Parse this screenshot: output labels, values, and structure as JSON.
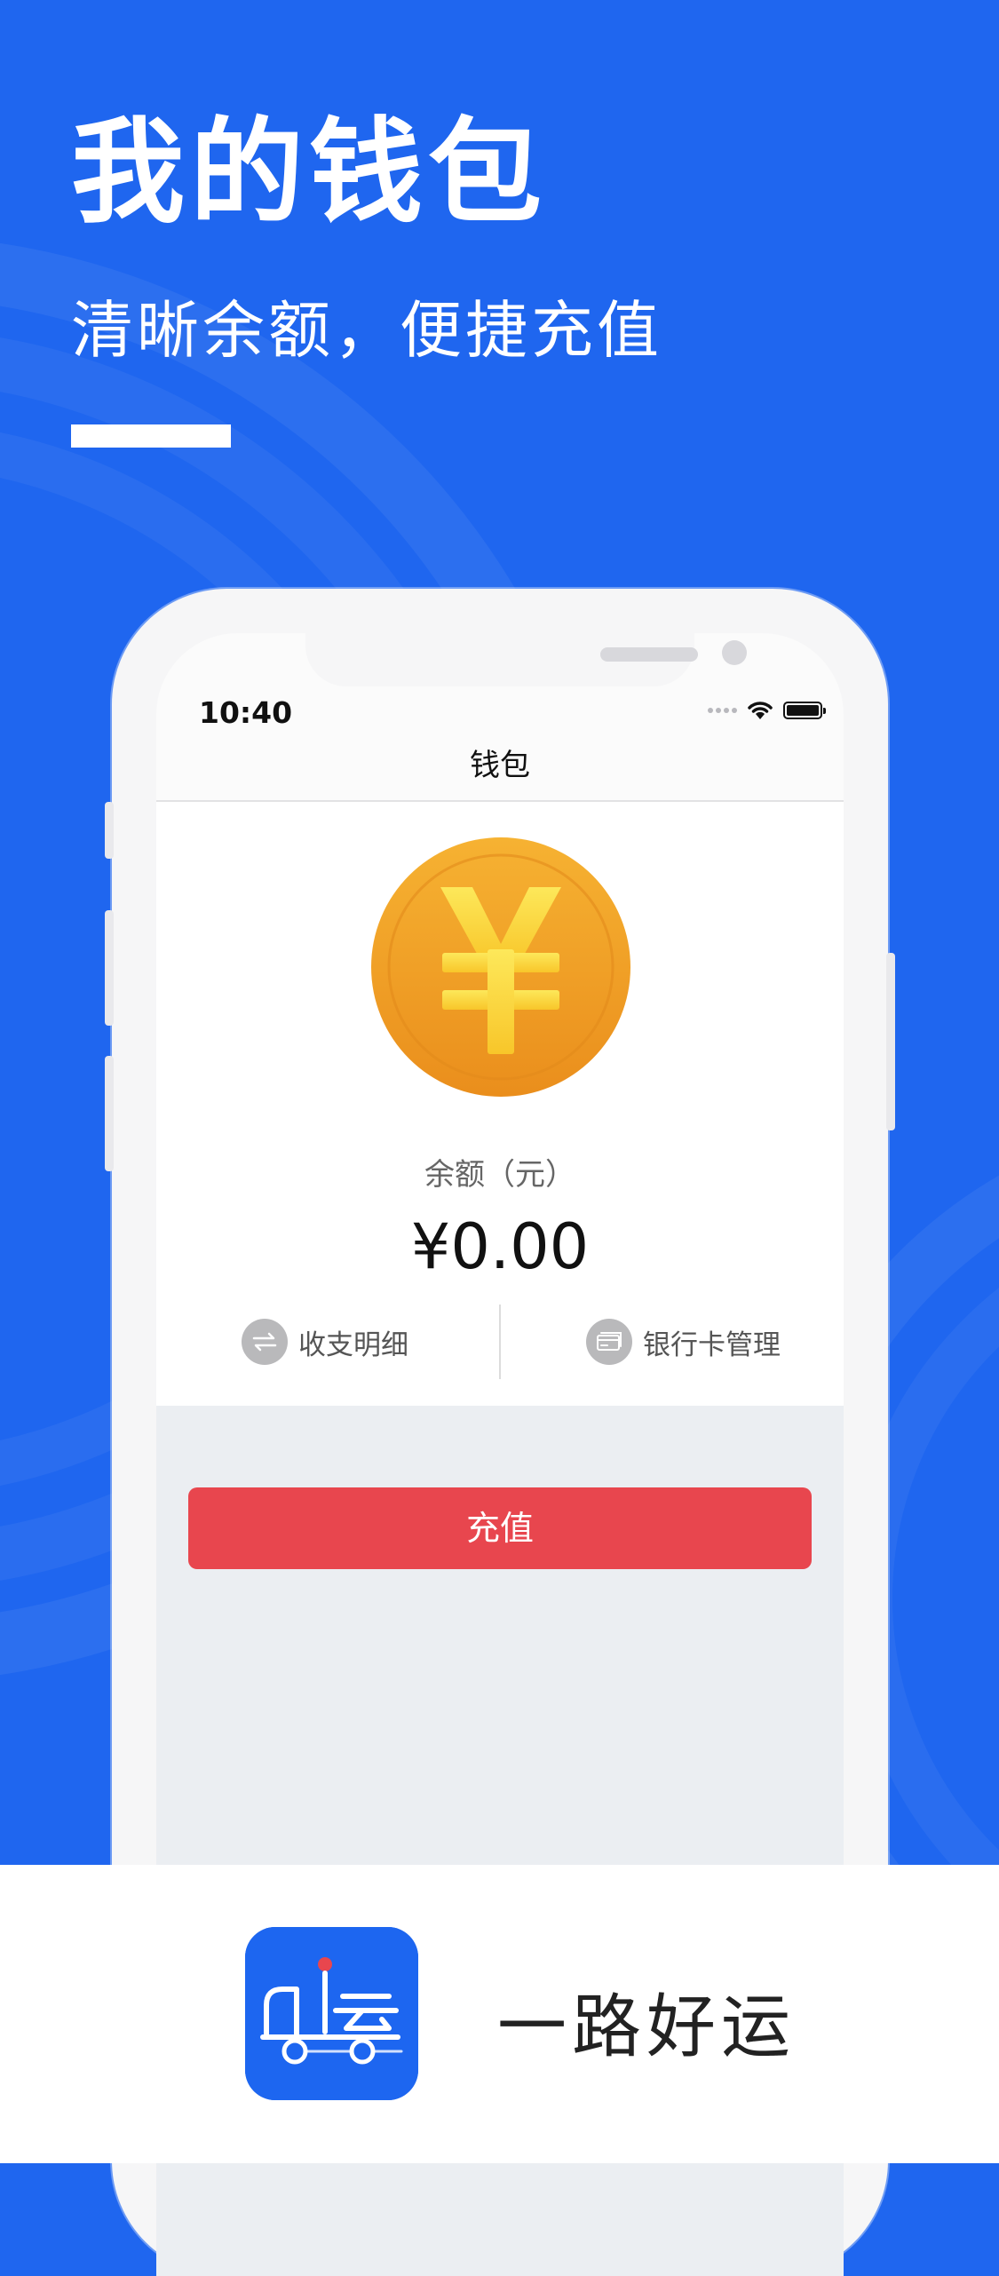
{
  "hero": {
    "title": "我的钱包",
    "subtitle": "清晰余额，便捷充值"
  },
  "status_bar": {
    "time": "10:40"
  },
  "nav": {
    "title": "钱包"
  },
  "wallet": {
    "balance_label": "余额（元）",
    "balance_amount": "¥0.00",
    "actions": [
      {
        "label": "收支明细",
        "icon": "transfer-icon"
      },
      {
        "label": "银行卡管理",
        "icon": "bank-card-icon"
      }
    ]
  },
  "recharge": {
    "label": "充值"
  },
  "app": {
    "name": "一路好运",
    "icon": "truck-icon"
  },
  "colors": {
    "brand_blue": "#1f66ef",
    "recharge_red": "#e8464e",
    "coin_gold": "#f2a52b"
  }
}
